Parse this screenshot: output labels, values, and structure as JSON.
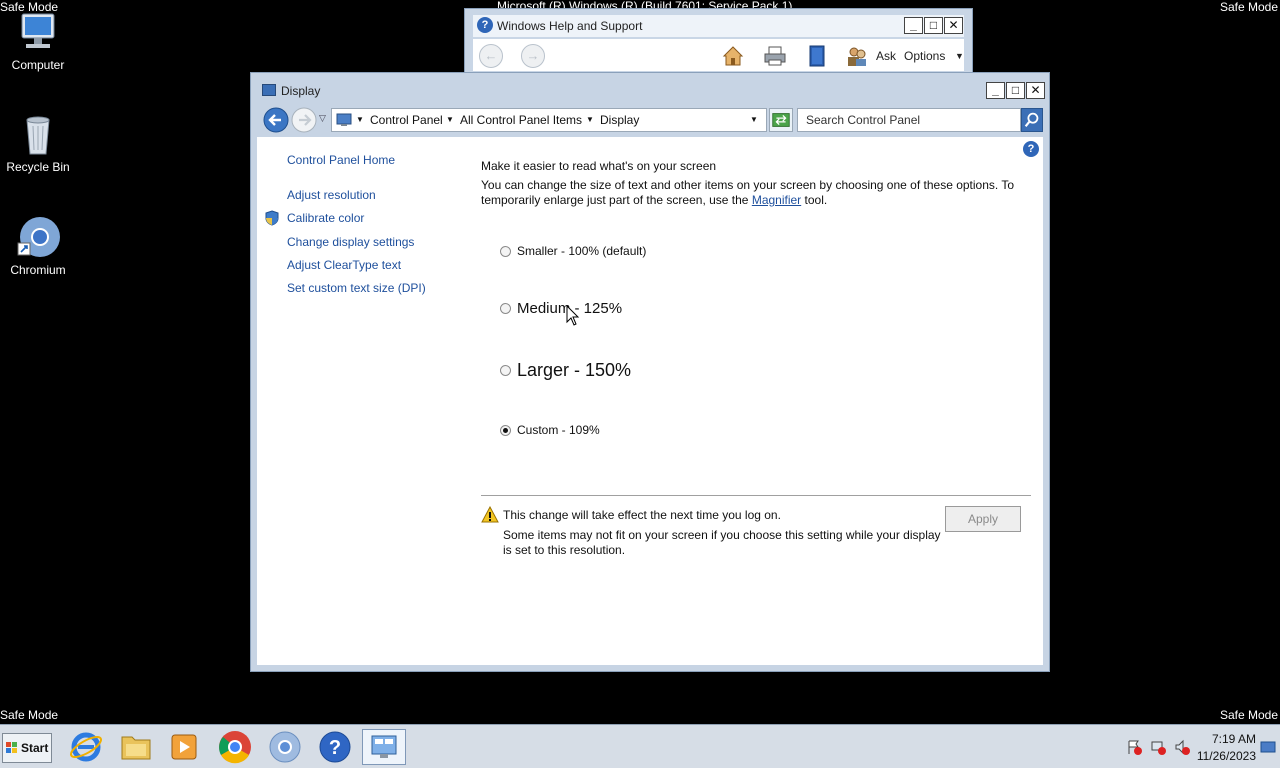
{
  "desktop": {
    "corner_labels": {
      "top_left": "Safe Mode",
      "top_right": "Safe Mode",
      "bottom_left": "Safe Mode",
      "bottom_right": "Safe Mode"
    },
    "build_text": "Microsoft (R) Windows (R) (Build 7601: Service Pack 1)",
    "icons": [
      {
        "label": "Computer",
        "icon": "computer-icon"
      },
      {
        "label": "Recycle Bin",
        "icon": "recycle-bin-icon"
      },
      {
        "label": "Chromium",
        "icon": "chromium-icon"
      }
    ]
  },
  "help_window": {
    "title": "Windows Help and Support",
    "toolbar": {
      "ask_label": "Ask",
      "options_label": "Options"
    }
  },
  "display_window": {
    "title": "Display",
    "address": {
      "crumbs": [
        "Control Panel",
        "All Control Panel Items",
        "Display"
      ]
    },
    "search_placeholder": "Search Control Panel",
    "sidebar": [
      "Control Panel Home",
      "Adjust resolution",
      "Calibrate color",
      "Change display settings",
      "Adjust ClearType text",
      "Set custom text size (DPI)"
    ],
    "heading": "Make it easier to read what's on your screen",
    "description_before": "You can change the size of text and other items on your screen by choosing one of these options. To temporarily enlarge just part of the screen, use the",
    "description_link": "Magnifier",
    "description_after": "tool.",
    "options": [
      {
        "label": "Smaller - 100% (default)",
        "selected": false
      },
      {
        "label": "Medium - 125%",
        "selected": false
      },
      {
        "label": "Larger - 150%",
        "selected": false
      },
      {
        "label": "Custom - 109%",
        "selected": true
      }
    ],
    "warning_title": "This change will take effect the next time you log on.",
    "warning_detail": "Some items may not fit on your screen if you choose this setting while your display is set to this resolution.",
    "apply_label": "Apply"
  },
  "taskbar": {
    "start_label": "Start",
    "clock_time": "7:19 AM",
    "clock_date": "11/26/2023",
    "pinned": [
      "internet-explorer-icon",
      "explorer-folder-icon",
      "media-player-icon",
      "chrome-icon",
      "chromium-icon",
      "help-icon",
      "display-control-panel-icon"
    ]
  },
  "colors": {
    "link": "#1e4f9c",
    "title_bar": "#c7d4e4",
    "desktop": "#000000"
  }
}
